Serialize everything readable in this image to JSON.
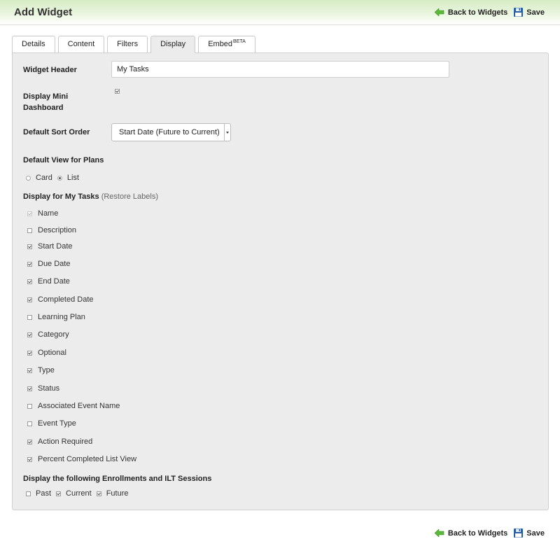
{
  "header": {
    "title": "Add Widget",
    "back_label": "Back to Widgets",
    "save_label": "Save"
  },
  "tabs": [
    {
      "label": "Details",
      "active": false
    },
    {
      "label": "Content",
      "active": false
    },
    {
      "label": "Filters",
      "active": false
    },
    {
      "label": "Display",
      "active": true
    },
    {
      "label": "Embed",
      "badge": "BETA",
      "active": false
    }
  ],
  "form": {
    "widget_header": {
      "label": "Widget Header",
      "value": "My Tasks"
    },
    "mini_dashboard": {
      "label_line1": "Display Mini",
      "label_line2": "Dashboard",
      "checked": true
    },
    "sort_order": {
      "label": "Default Sort Order",
      "value": "Start Date (Future to Current)"
    },
    "default_view": {
      "label": "Default View for Plans",
      "options": [
        {
          "label": "Card",
          "selected": false
        },
        {
          "label": "List",
          "selected": true
        }
      ]
    },
    "display_fields": {
      "label": "Display for My Tasks",
      "restore_link": "(Restore Labels)",
      "items": [
        {
          "label": "Name",
          "checked": true,
          "disabled": true
        },
        {
          "label": "Description",
          "checked": false
        },
        {
          "label": "Start Date",
          "checked": true
        },
        {
          "label": "Due Date",
          "checked": true
        },
        {
          "label": "End Date",
          "checked": true
        },
        {
          "label": "Completed Date",
          "checked": true
        },
        {
          "label": "Learning Plan",
          "checked": false
        },
        {
          "label": "Category",
          "checked": true
        },
        {
          "label": "Optional",
          "checked": true
        },
        {
          "label": "Type",
          "checked": true
        },
        {
          "label": "Status",
          "checked": true
        },
        {
          "label": "Associated Event Name",
          "checked": false
        },
        {
          "label": "Event Type",
          "checked": false
        },
        {
          "label": "Action Required",
          "checked": true
        },
        {
          "label": "Percent Completed List View",
          "checked": true
        }
      ]
    },
    "enrollments": {
      "label": "Display the following Enrollments and ILT Sessions",
      "options": [
        {
          "label": "Past",
          "checked": false
        },
        {
          "label": "Current",
          "checked": true
        },
        {
          "label": "Future",
          "checked": true
        }
      ]
    }
  },
  "colors": {
    "header_gradient_top": "#d6ecc4",
    "panel_bg": "#ececec",
    "back_arrow": "#5cb83a",
    "save_icon": "#2a5fa8"
  },
  "icons": {
    "back": "green-left-arrow-icon",
    "save": "floppy-disk-icon"
  }
}
